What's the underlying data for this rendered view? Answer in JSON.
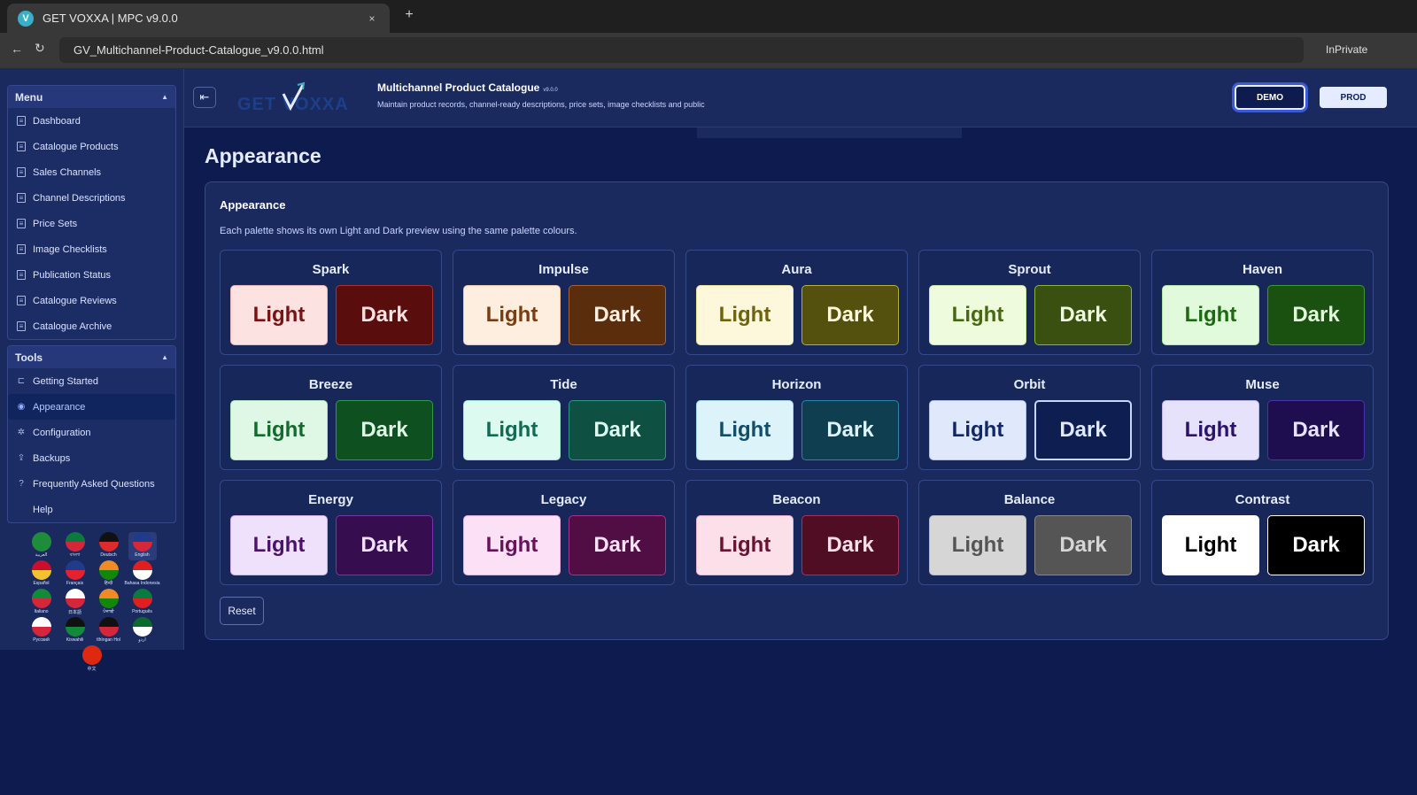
{
  "browser": {
    "tab_title": "GET VOXXA | MPC v9.0.0",
    "tab_icon_letter": "V",
    "tab_close": "×",
    "new_tab": "+",
    "back": "←",
    "reload": "↻",
    "url": "GV_Multichannel-Product-Catalogue_v9.0.0.html",
    "mode": "InPrivate"
  },
  "sidebar": {
    "menu_label": "Menu",
    "menu_items": [
      {
        "label": "Dashboard"
      },
      {
        "label": "Catalogue Products"
      },
      {
        "label": "Sales Channels"
      },
      {
        "label": "Channel Descriptions"
      },
      {
        "label": "Price Sets"
      },
      {
        "label": "Image Checklists"
      },
      {
        "label": "Publication Status"
      },
      {
        "label": "Catalogue Reviews"
      },
      {
        "label": "Catalogue Archive"
      }
    ],
    "tools_label": "Tools",
    "tools_items": [
      {
        "label": "Getting Started",
        "icon": "⊏"
      },
      {
        "label": "Appearance",
        "icon": "◉"
      },
      {
        "label": "Configuration",
        "icon": "✲"
      },
      {
        "label": "Backups",
        "icon": "⇪"
      },
      {
        "label": "Frequently Asked Questions",
        "icon": "?"
      },
      {
        "label": "Help",
        "icon": ""
      }
    ],
    "languages": [
      {
        "label": "العربية",
        "colors": [
          "#1e8c3a",
          "#1e8c3a"
        ]
      },
      {
        "label": "বাংলা",
        "colors": [
          "#0b7a3e",
          "#d6273a"
        ]
      },
      {
        "label": "Deutsch",
        "colors": [
          "#111111",
          "#dd2a2a"
        ]
      },
      {
        "label": "English",
        "colors": [
          "#1f3b8c",
          "#d6273a"
        ]
      },
      {
        "label": "Español",
        "colors": [
          "#c8102e",
          "#f2c230"
        ]
      },
      {
        "label": "Français",
        "colors": [
          "#1f3b8c",
          "#e6202e"
        ]
      },
      {
        "label": "हिन्दी",
        "colors": [
          "#f08a24",
          "#138808"
        ]
      },
      {
        "label": "Bahasa Indonesia",
        "colors": [
          "#e02020",
          "#ffffff"
        ]
      },
      {
        "label": "Italiano",
        "colors": [
          "#138a3a",
          "#d6273a"
        ]
      },
      {
        "label": "日本語",
        "colors": [
          "#ffffff",
          "#d6273a"
        ]
      },
      {
        "label": "ਪੰਜਾਬੀ",
        "colors": [
          "#f08a24",
          "#138808"
        ]
      },
      {
        "label": "Português",
        "colors": [
          "#0b7a3e",
          "#e02020"
        ]
      },
      {
        "label": "Русский",
        "colors": [
          "#ffffff",
          "#d6273a"
        ]
      },
      {
        "label": "Kiswahili",
        "colors": [
          "#111111",
          "#138a3a"
        ]
      },
      {
        "label": "tlhIngan Hol",
        "colors": [
          "#111111",
          "#d6273a"
        ]
      },
      {
        "label": "اردو",
        "colors": [
          "#0b6b2e",
          "#ffffff"
        ]
      },
      {
        "label": "中文",
        "colors": [
          "#de2910",
          "#de2910"
        ]
      }
    ]
  },
  "header": {
    "collapse_icon": "⇤",
    "logo_text": "GET VOXXA",
    "title": "Multichannel Product Catalogue",
    "version": "v9.0.0",
    "subtitle": "Maintain product records, channel-ready descriptions, price sets, image checklists and public",
    "demo_label": "DEMO",
    "prod_label": "PROD"
  },
  "main": {
    "page_title": "Appearance",
    "panel_title": "Appearance",
    "panel_desc": "Each palette shows its own Light and Dark preview using the same palette colours.",
    "light_label": "Light",
    "dark_label": "Dark",
    "reset_label": "Reset",
    "palettes": [
      {
        "name": "Spark",
        "light": {
          "bg": "#fde2e2",
          "fg": "#7a1212",
          "border": "#f0b5b5"
        },
        "dark": {
          "bg": "#5a0d0d",
          "fg": "#fde2e2",
          "border": "#a83232"
        }
      },
      {
        "name": "Impulse",
        "light": {
          "bg": "#fdeee0",
          "fg": "#7a3d12",
          "border": "#f0c9a8"
        },
        "dark": {
          "bg": "#5a2e0d",
          "fg": "#fdeee0",
          "border": "#b0622a"
        }
      },
      {
        "name": "Aura",
        "light": {
          "bg": "#fdf8dc",
          "fg": "#6e6410",
          "border": "#ece29a"
        },
        "dark": {
          "bg": "#54500e",
          "fg": "#fdf8dc",
          "border": "#b8ac32"
        }
      },
      {
        "name": "Sprout",
        "light": {
          "bg": "#eefbdc",
          "fg": "#466812",
          "border": "#cbe6a0"
        },
        "dark": {
          "bg": "#3a5010",
          "fg": "#eefbdc",
          "border": "#8ab43a"
        }
      },
      {
        "name": "Haven",
        "light": {
          "bg": "#e2fadc",
          "fg": "#1d6a12",
          "border": "#b4e6a8"
        },
        "dark": {
          "bg": "#1a5010",
          "fg": "#e2fadc",
          "border": "#3e9a2e"
        }
      },
      {
        "name": "Breeze",
        "light": {
          "bg": "#dff8e6",
          "fg": "#126a2c",
          "border": "#aee4bd"
        },
        "dark": {
          "bg": "#0f5020",
          "fg": "#dff8e6",
          "border": "#2e9a4a"
        }
      },
      {
        "name": "Tide",
        "light": {
          "bg": "#dcfaf0",
          "fg": "#126a52",
          "border": "#a6e6d2"
        },
        "dark": {
          "bg": "#0e5042",
          "fg": "#dcfaf0",
          "border": "#2a9a7e"
        }
      },
      {
        "name": "Horizon",
        "light": {
          "bg": "#dcf3fa",
          "fg": "#124e6a",
          "border": "#a6d8ec"
        },
        "dark": {
          "bg": "#0e3e50",
          "fg": "#dcf3fa",
          "border": "#2a86a8"
        }
      },
      {
        "name": "Orbit",
        "light": {
          "bg": "#e0e8fb",
          "fg": "#12266a",
          "border": "#b0c0ec"
        },
        "dark": {
          "bg": "#0e1e50",
          "fg": "#e0e8fb",
          "border": "#c8d6ff"
        }
      },
      {
        "name": "Muse",
        "light": {
          "bg": "#e6e2fb",
          "fg": "#2c126a",
          "border": "#bfb4ec"
        },
        "dark": {
          "bg": "#1e0e50",
          "fg": "#e6e2fb",
          "border": "#4a32a8"
        }
      },
      {
        "name": "Energy",
        "light": {
          "bg": "#efe0fb",
          "fg": "#4a126a",
          "border": "#d2b0ec"
        },
        "dark": {
          "bg": "#360e50",
          "fg": "#efe0fb",
          "border": "#7a32a8"
        }
      },
      {
        "name": "Legacy",
        "light": {
          "bg": "#fbe0f6",
          "fg": "#6a1258",
          "border": "#ecb0e0"
        },
        "dark": {
          "bg": "#500e44",
          "fg": "#fbe0f6",
          "border": "#a8328e"
        }
      },
      {
        "name": "Beacon",
        "light": {
          "bg": "#fbe0ea",
          "fg": "#6a1230",
          "border": "#ecb0c4"
        },
        "dark": {
          "bg": "#500e24",
          "fg": "#fbe0ea",
          "border": "#a8325a"
        }
      },
      {
        "name": "Balance",
        "light": {
          "bg": "#d6d6d6",
          "fg": "#555555",
          "border": "#bbbbbb"
        },
        "dark": {
          "bg": "#555555",
          "fg": "#d6d6d6",
          "border": "#888888"
        }
      },
      {
        "name": "Contrast",
        "light": {
          "bg": "#ffffff",
          "fg": "#000000",
          "border": "#ffffff"
        },
        "dark": {
          "bg": "#000000",
          "fg": "#ffffff",
          "border": "#ffffff"
        }
      }
    ]
  },
  "colors": {
    "app_bg": "#0d1b4f",
    "panel_bg": "#1a2a5e",
    "accent": "#3a5ad8"
  }
}
